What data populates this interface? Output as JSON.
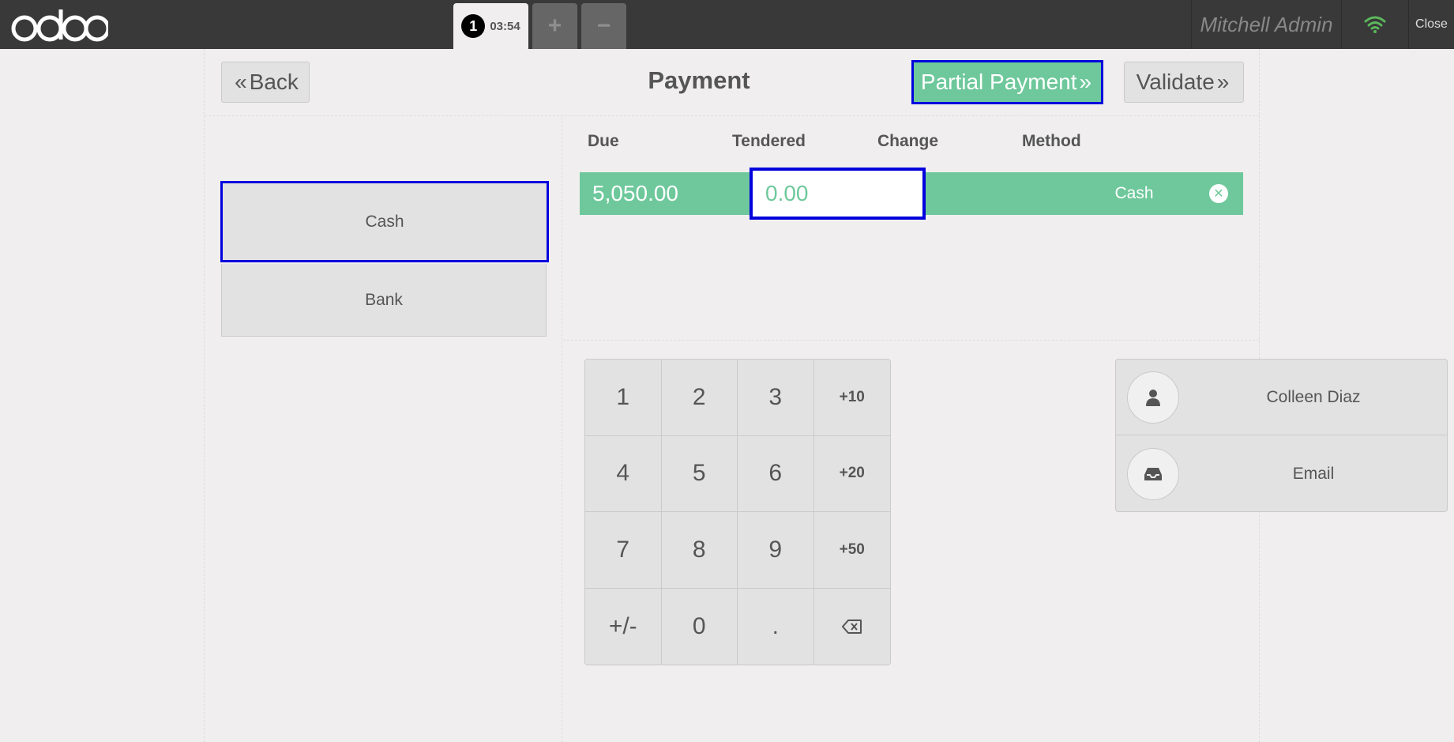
{
  "topbar": {
    "order_number": "1",
    "order_time": "03:54",
    "add_tab": "+",
    "remove_tab": "−",
    "user_name": "Mitchell Admin",
    "close_label": "Close"
  },
  "header": {
    "back_label": "Back",
    "title": "Payment",
    "partial_payment_label": "Partial Payment",
    "validate_label": "Validate"
  },
  "payment_methods": [
    "Cash",
    "Bank"
  ],
  "lines": {
    "columns": [
      "Due",
      "Tendered",
      "Change",
      "Method"
    ],
    "row": {
      "due": "5,050.00",
      "tendered": "0.00",
      "change": "",
      "method": "Cash"
    }
  },
  "numpad": {
    "keys": [
      "1",
      "2",
      "3",
      "+10",
      "4",
      "5",
      "6",
      "+20",
      "7",
      "8",
      "9",
      "+50",
      "+/-",
      "0",
      ".",
      ""
    ]
  },
  "extras": {
    "customer": "Colleen Diaz",
    "email": "Email"
  },
  "colors": {
    "accent_green": "#6ec89b",
    "topbar": "#393939",
    "highlight_border": "#0000dd",
    "wifi": "#5cb85c"
  },
  "icons": [
    "odoo-logo",
    "wifi-icon",
    "user-icon",
    "inbox-icon",
    "backspace-icon",
    "remove-line-icon",
    "chevron-left-icon",
    "chevron-right-icon"
  ]
}
